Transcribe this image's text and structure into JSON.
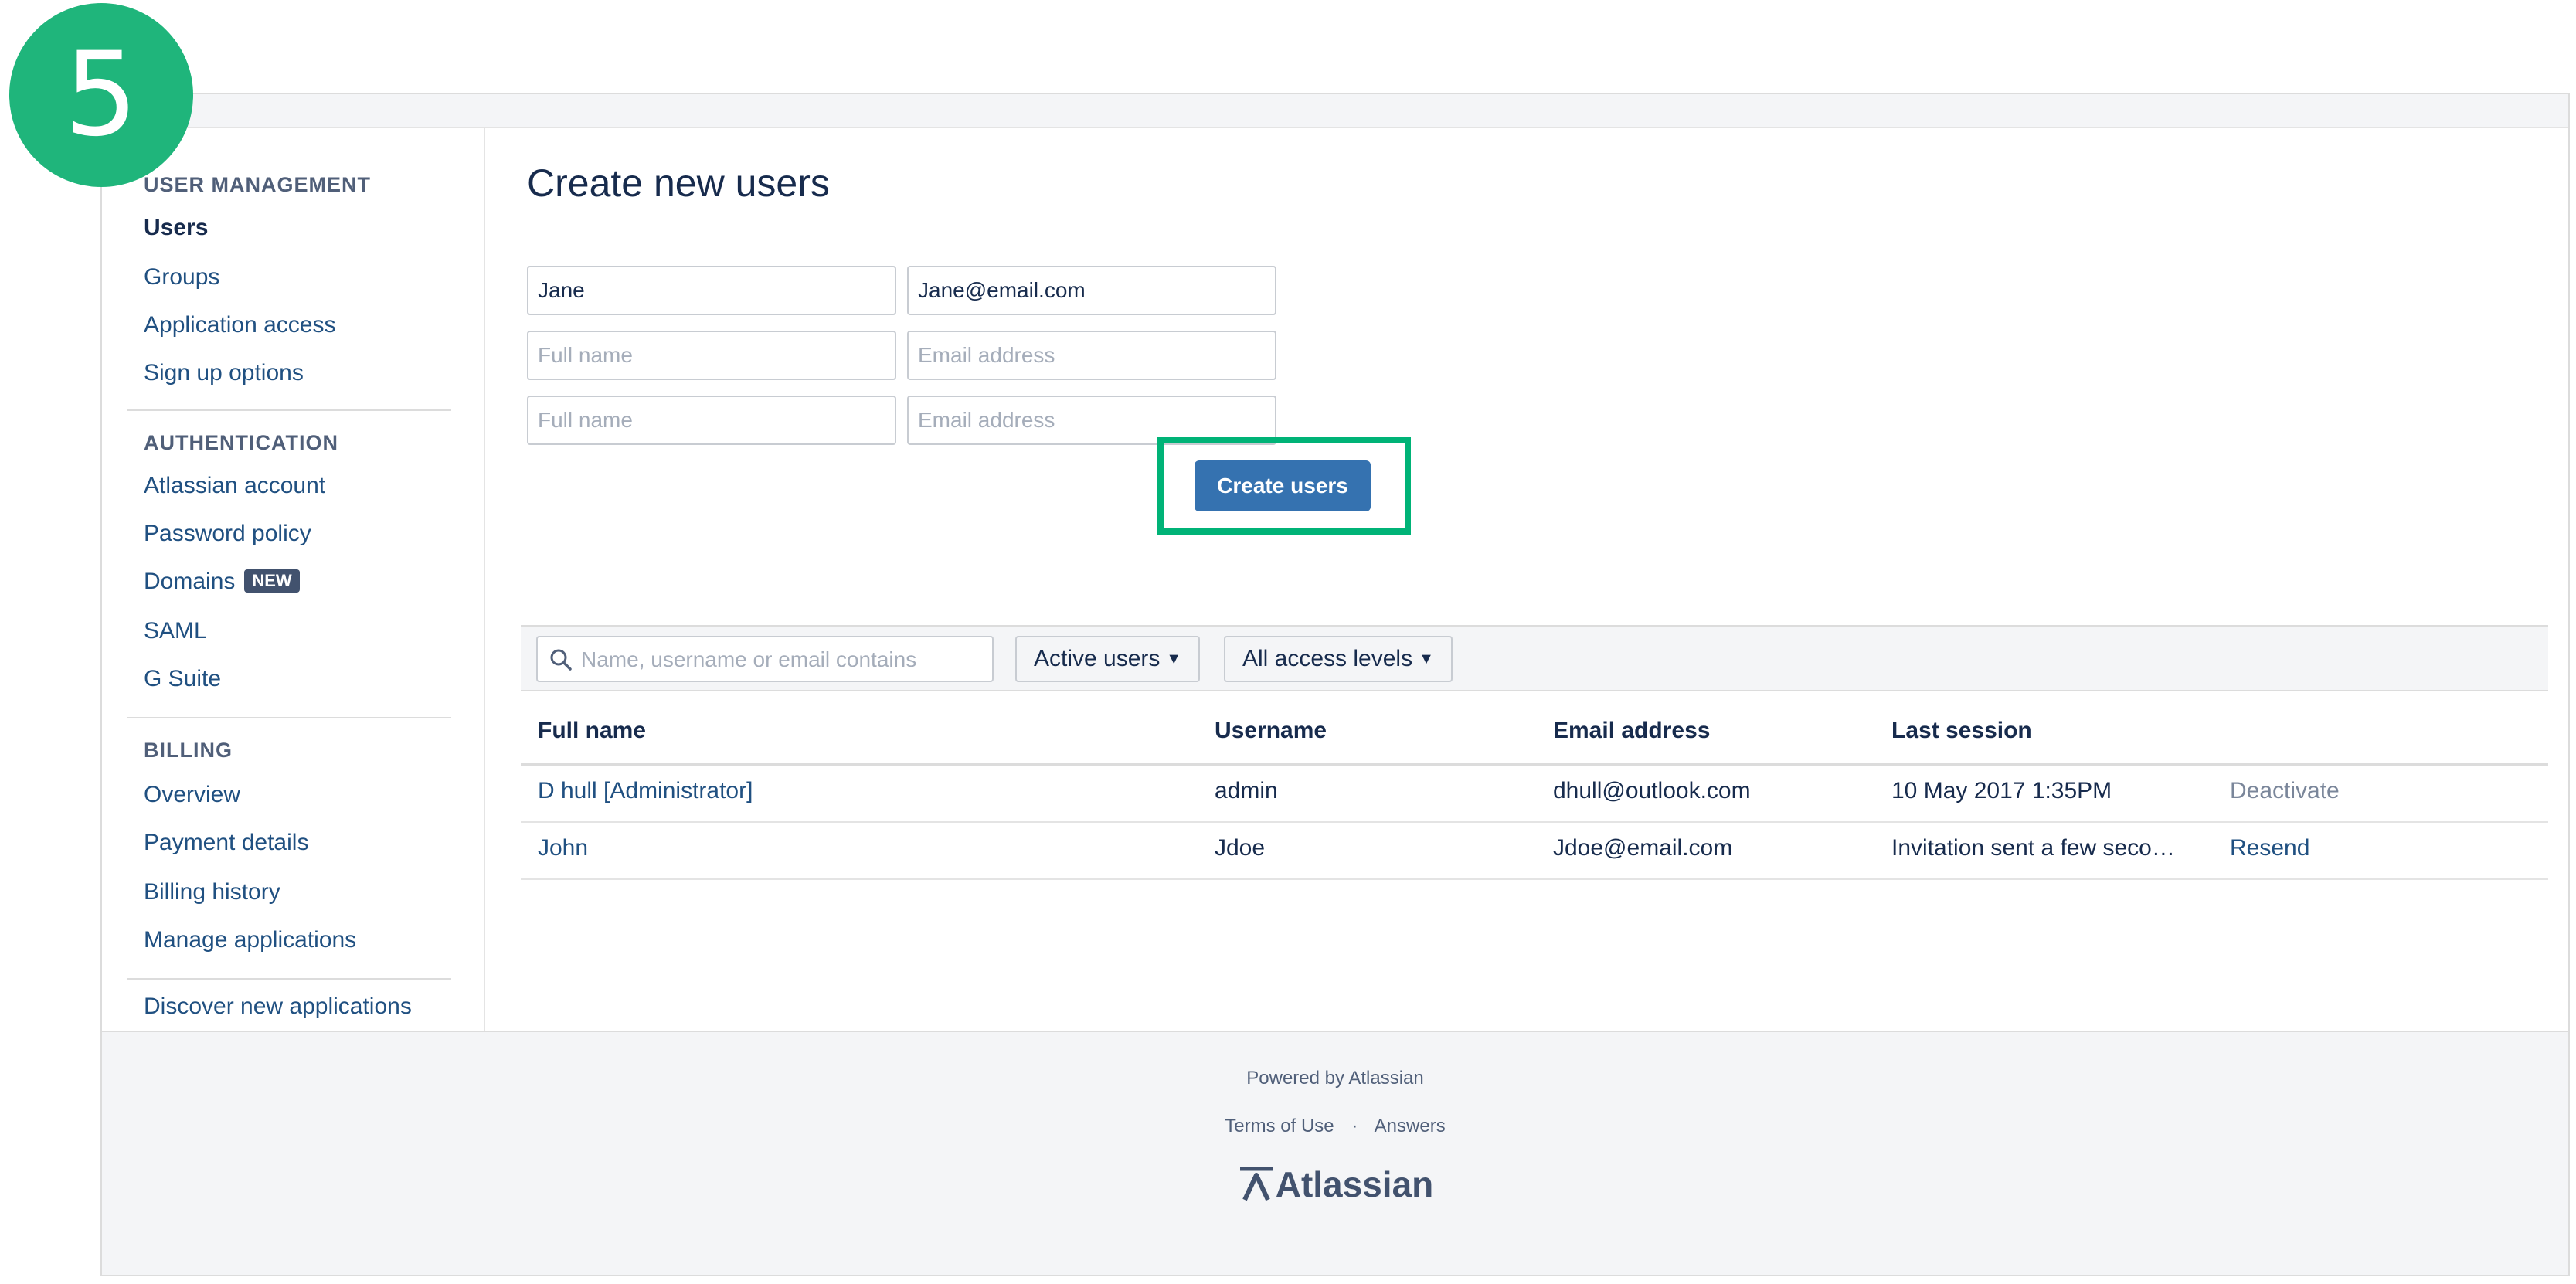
{
  "step_number": "5",
  "sidebar": {
    "sections": [
      {
        "heading": "USER MANAGEMENT",
        "items": [
          "Users",
          "Groups",
          "Application access",
          "Sign up options"
        ]
      },
      {
        "heading": "AUTHENTICATION",
        "items": [
          "Atlassian account",
          "Password policy",
          "Domains",
          "SAML",
          "G Suite"
        ]
      },
      {
        "heading": "BILLING",
        "items": [
          "Overview",
          "Payment details",
          "Billing history",
          "Manage applications"
        ]
      }
    ],
    "active_item": "Users",
    "domains_badge": "NEW",
    "discover_link": "Discover new applications"
  },
  "main": {
    "title": "Create new users",
    "create_form": {
      "rows": [
        {
          "name_value": "Jane",
          "email_value": "Jane@email.com"
        },
        {
          "name_value": "",
          "email_value": ""
        },
        {
          "name_value": "",
          "email_value": ""
        }
      ],
      "name_placeholder": "Full name",
      "email_placeholder": "Email address",
      "submit_label": "Create users"
    },
    "filters": {
      "search_placeholder": "Name, username or email contains",
      "status_dropdown": "Active users",
      "access_dropdown": "All access levels"
    },
    "table": {
      "columns": [
        "Full name",
        "Username",
        "Email address",
        "Last session"
      ],
      "rows": [
        {
          "full_name": "D hull [Administrator]",
          "username": "admin",
          "email": "dhull@outlook.com",
          "last_session": "10 May 2017 1:35PM",
          "action": "Deactivate"
        },
        {
          "full_name": "John",
          "username": "Jdoe",
          "email": "Jdoe@email.com",
          "last_session": "Invitation sent a few secon…",
          "action": "Resend"
        }
      ]
    }
  },
  "footer": {
    "powered_by": "Powered by Atlassian",
    "terms_link": "Terms of Use",
    "separator": "·",
    "answers_link": "Answers",
    "logo_text": "Atlassian"
  },
  "colors": {
    "link": "#205081",
    "primary_button": "#3572b0",
    "highlight_box": "#00b377",
    "step_badge": "#1fb57b"
  }
}
